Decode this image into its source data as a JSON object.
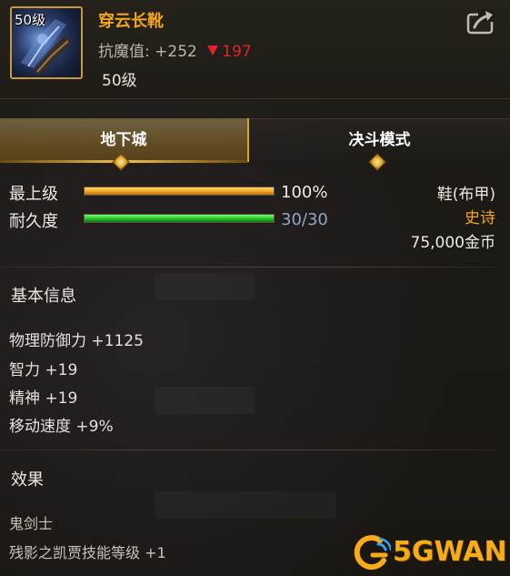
{
  "item": {
    "icon_level": "50级",
    "name": "穿云长靴",
    "resist_label": "抗魔值:",
    "resist_value": "+252",
    "resist_change": "197",
    "level_text": "50级"
  },
  "tabs": [
    {
      "label": "地下城",
      "active": true
    },
    {
      "label": "决斗模式",
      "active": false
    }
  ],
  "stats": {
    "top_level_label": "最上级",
    "top_level_value": "100%",
    "top_level_fraction": 1.0,
    "durability_label": "耐久度",
    "durability_value": "30/30",
    "durability_fraction": 1.0
  },
  "right_info": {
    "type": "鞋(布甲)",
    "grade": "史诗",
    "price": "75,000金币"
  },
  "basic_info": {
    "title": "基本信息",
    "attrs": [
      "物理防御力 +1125",
      "智力 +19",
      "精神 +19",
      "移动速度 +9%"
    ]
  },
  "effects": {
    "title": "效果",
    "lines": [
      "鬼剑士",
      "残影之凯贾技能等级 +1"
    ]
  },
  "watermark": {
    "text": "5GWAN"
  },
  "colors": {
    "item_name": "#f2a51a",
    "grade_epic": "#f2a51a",
    "decrease": "#e0242c",
    "durability_value": "#8fa7c4",
    "tab_accent": "#d9a530"
  },
  "icons": {
    "share": "share-export-icon",
    "decrease": "red-down-triangle-icon"
  }
}
